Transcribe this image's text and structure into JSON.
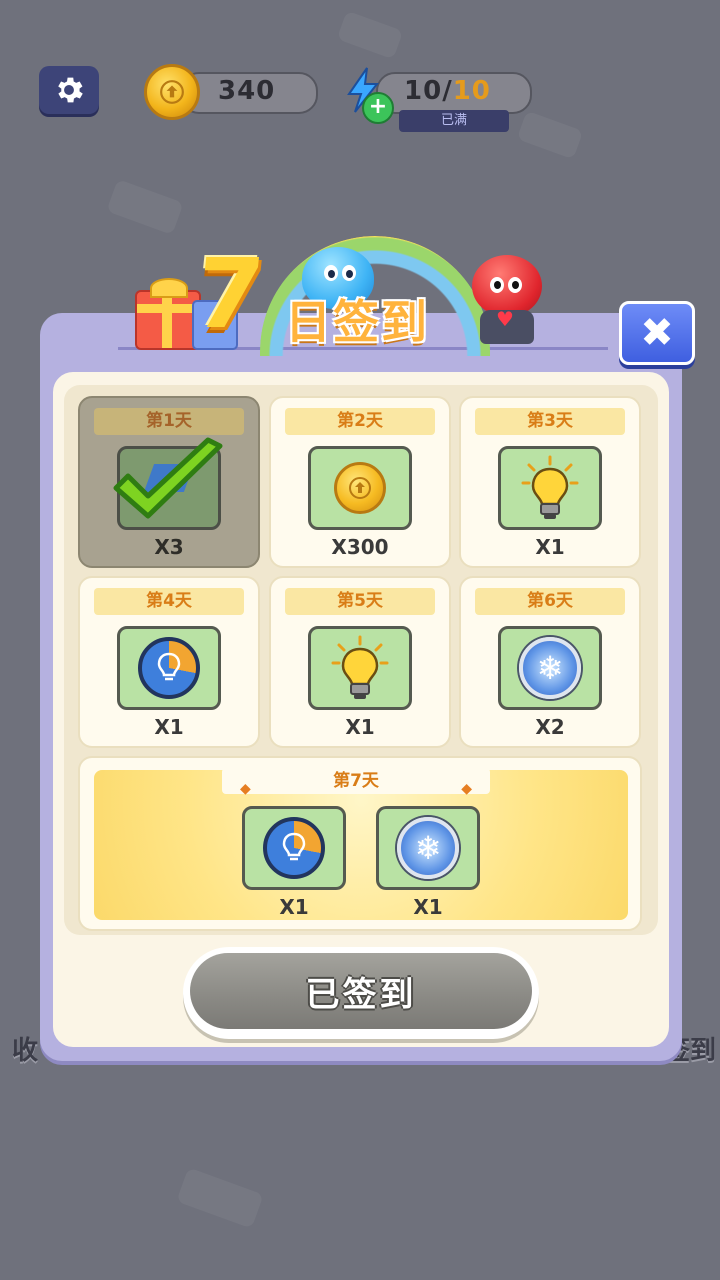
{
  "hud": {
    "coins": "340",
    "energy_current": "10",
    "energy_separator": "/",
    "energy_max": "10",
    "energy_status": "已满"
  },
  "dialog": {
    "title_number": "7",
    "title_text": "日签到",
    "close_glyph": "✖",
    "days": [
      {
        "label": "第1天",
        "qty": "X3",
        "icon": "checkmark-icon",
        "claimed": true
      },
      {
        "label": "第2天",
        "qty": "X300",
        "icon": "coin-icon",
        "claimed": false
      },
      {
        "label": "第3天",
        "qty": "X1",
        "icon": "lightbulb-icon",
        "claimed": false
      },
      {
        "label": "第4天",
        "qty": "X1",
        "icon": "hint-clock-icon",
        "claimed": false
      },
      {
        "label": "第5天",
        "qty": "X1",
        "icon": "lightbulb-icon",
        "claimed": false
      },
      {
        "label": "第6天",
        "qty": "X2",
        "icon": "freeze-timer-icon",
        "claimed": false
      }
    ],
    "day7": {
      "label": "第7天",
      "rewards": [
        {
          "qty": "X1",
          "icon": "hint-clock-icon"
        },
        {
          "qty": "X1",
          "icon": "freeze-timer-icon"
        }
      ]
    },
    "signed_button_label": "已签到"
  },
  "side_menu": {
    "left_bottom_label": "收",
    "right_bottom_label": "签到"
  },
  "colors": {
    "overlay_bg": "#6f717c",
    "panel_border": "#b5b1e0",
    "panel_inner": "#fbf5e6",
    "day_label_text": "#d97d17",
    "reward_tile": "#b9e2a4",
    "close_button": "#4f6ee8"
  }
}
